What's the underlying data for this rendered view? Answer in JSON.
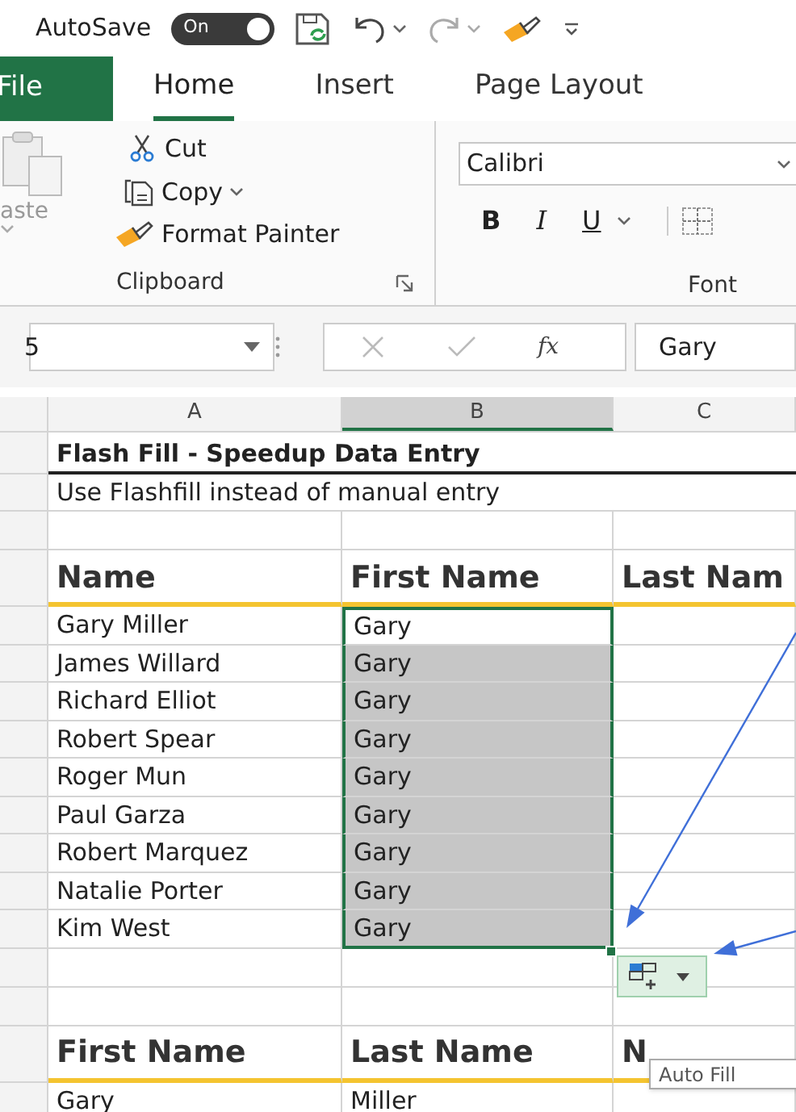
{
  "quick_access": {
    "autosave_label": "AutoSave",
    "toggle": {
      "label": "On",
      "on": true
    }
  },
  "tabs": [
    {
      "label": "File",
      "kind": "file",
      "selected": false
    },
    {
      "label": "Home",
      "kind": "tab",
      "selected": true
    },
    {
      "label": "Insert",
      "kind": "tab",
      "selected": false
    },
    {
      "label": "Page Layout",
      "kind": "tab",
      "selected": false
    }
  ],
  "clipboard": {
    "paste_label": "aste",
    "cut_label": "Cut",
    "copy_label": "Copy",
    "format_painter_label": "Format Painter",
    "group_label": "Clipboard"
  },
  "font": {
    "font_name": "Calibri",
    "bold_label": "B",
    "italic_label": "I",
    "underline_label": "U",
    "group_label": "Font"
  },
  "formula_bar": {
    "name_box": "5",
    "function_label": "fx",
    "value": "Gary"
  },
  "columns": [
    {
      "label": "A",
      "selected": false
    },
    {
      "label": "B",
      "selected": true
    },
    {
      "label": "C",
      "selected": false
    }
  ],
  "rows": [
    {
      "kind": "title",
      "cells": [
        "Flash Fill - Speedup Data Entry"
      ]
    },
    {
      "kind": "note",
      "cells": [
        "Use Flashfill instead of manual entry"
      ]
    },
    {
      "kind": "blank"
    },
    {
      "kind": "header",
      "cells": [
        "Name",
        "First Name",
        "Last Nam"
      ]
    },
    {
      "kind": "data",
      "cells": [
        "Gary Miller",
        "Gary"
      ],
      "selected": true,
      "flash_filled": false
    },
    {
      "kind": "data",
      "cells": [
        "James Willard",
        "Gary"
      ],
      "selected": true,
      "flash_filled": true
    },
    {
      "kind": "data",
      "cells": [
        "Richard Elliot",
        "Gary"
      ],
      "selected": true,
      "flash_filled": true
    },
    {
      "kind": "data",
      "cells": [
        "Robert Spear",
        "Gary"
      ],
      "selected": true,
      "flash_filled": true
    },
    {
      "kind": "data",
      "cells": [
        "Roger Mun",
        "Gary"
      ],
      "selected": true,
      "flash_filled": true
    },
    {
      "kind": "data",
      "cells": [
        "Paul Garza",
        "Gary"
      ],
      "selected": true,
      "flash_filled": true
    },
    {
      "kind": "data",
      "cells": [
        "Robert Marquez",
        "Gary"
      ],
      "selected": true,
      "flash_filled": true
    },
    {
      "kind": "data",
      "cells": [
        "Natalie Porter",
        "Gary"
      ],
      "selected": true,
      "flash_filled": true
    },
    {
      "kind": "data",
      "cells": [
        "Kim West",
        "Gary"
      ],
      "selected": true,
      "flash_filled": true
    },
    {
      "kind": "blank"
    },
    {
      "kind": "blank"
    },
    {
      "kind": "header",
      "cells": [
        "First Name",
        "Last Name",
        "N"
      ]
    },
    {
      "kind": "data",
      "cells": [
        "Gary",
        "Miller"
      ],
      "selected": false,
      "flash_filled": false
    }
  ],
  "tooltip": {
    "text": "Auto Fill"
  }
}
